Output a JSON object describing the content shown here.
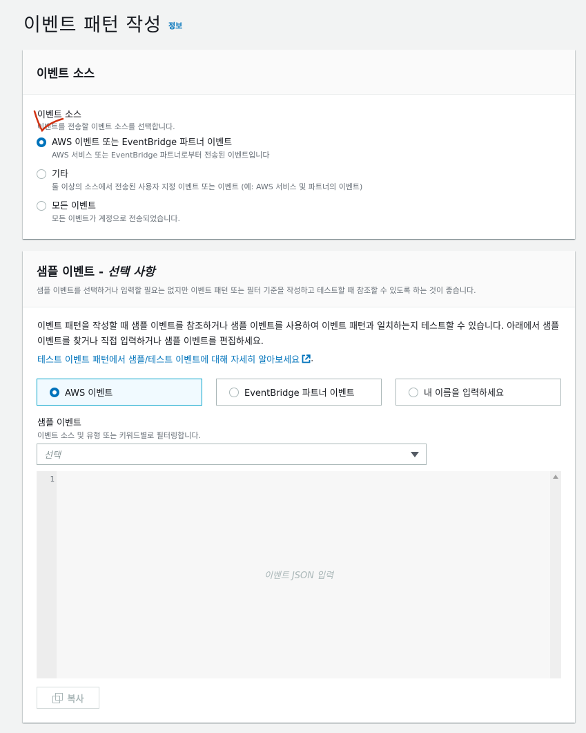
{
  "header": {
    "title": "이벤트 패턴 작성",
    "info": "정보"
  },
  "event_source_panel": {
    "title": "이벤트 소스",
    "field_label": "이벤트 소스",
    "field_desc": "이벤트를 전송할 이벤트 소스를 선택합니다.",
    "options": [
      {
        "label": "AWS 이벤트 또는 EventBridge 파트너 이벤트",
        "desc": "AWS 서비스 또는 EventBridge 파트너로부터 전송된 이벤트입니다",
        "checked": true
      },
      {
        "label": "기타",
        "desc": "둘 이상의 소스에서 전송된 사용자 지정 이벤트 또는 이벤트 (예: AWS 서비스 및 파트너의 이벤트)",
        "checked": false
      },
      {
        "label": "모든 이벤트",
        "desc": "모든 이벤트가 계정으로 전송되었습니다.",
        "checked": false
      }
    ]
  },
  "sample_panel": {
    "title": "샘플 이벤트 -",
    "title_optional": "선택 사항",
    "desc": "샘플 이벤트를 선택하거나 입력할 필요는 없지만 이벤트 패턴 또는 필터 기준을 작성하고 테스트할 때 참조할 수 있도록 하는 것이 좋습니다.",
    "body": "이벤트 패턴을 작성할 때 샘플 이벤트를 참조하거나 샘플 이벤트를 사용하여 이벤트 패턴과 일치하는지 테스트할 수 있습니다. 아래에서 샘플 이벤트를 찾거나 직접 입력하거나 샘플 이벤트를 편집하세요.",
    "learn_more": "테스트 이벤트 패턴에서 샘플/테스트 이벤트에 대해 자세히 알아보세요",
    "learn_more_suffix": ".",
    "tiles": [
      {
        "label": "AWS 이벤트",
        "selected": true
      },
      {
        "label": "EventBridge 파트너 이벤트",
        "selected": false
      },
      {
        "label": "내 이름을 입력하세요",
        "selected": false
      }
    ],
    "sample_label": "샘플 이벤트",
    "sample_desc": "이벤트 소스 및 유형 또는 키워드별로 필터링합니다.",
    "select_placeholder": "선택",
    "editor_line": "1",
    "editor_placeholder": "이벤트 JSON 입력",
    "copy_label": "복사"
  },
  "colors": {
    "accent": "#0073bb",
    "annotation": "#d13212"
  }
}
